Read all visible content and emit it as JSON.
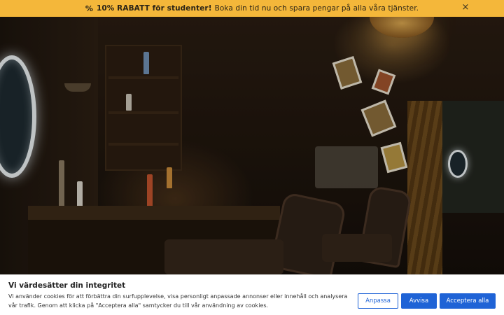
{
  "promo": {
    "icon": "percent-icon",
    "highlight": "10% RABATT för studenter!",
    "text": "Boka din tid nu och spara pengar på alla våra tjänster.",
    "close_label": "×",
    "background": "#f4b73a"
  },
  "cookie": {
    "title": "Vi värdesätter din integritet",
    "text": "Vi använder cookies för att förbättra din surfupplevelse, visa personligt anpassade annonser eller innehåll och analysera vår trafik. Genom att klicka på \"Acceptera alla\" samtycker du till vår användning av cookies.",
    "buttons": {
      "customize": "Anpassa",
      "reject": "Avvisa",
      "accept_all": "Acceptera alla"
    },
    "accent": "#1f63d6"
  }
}
